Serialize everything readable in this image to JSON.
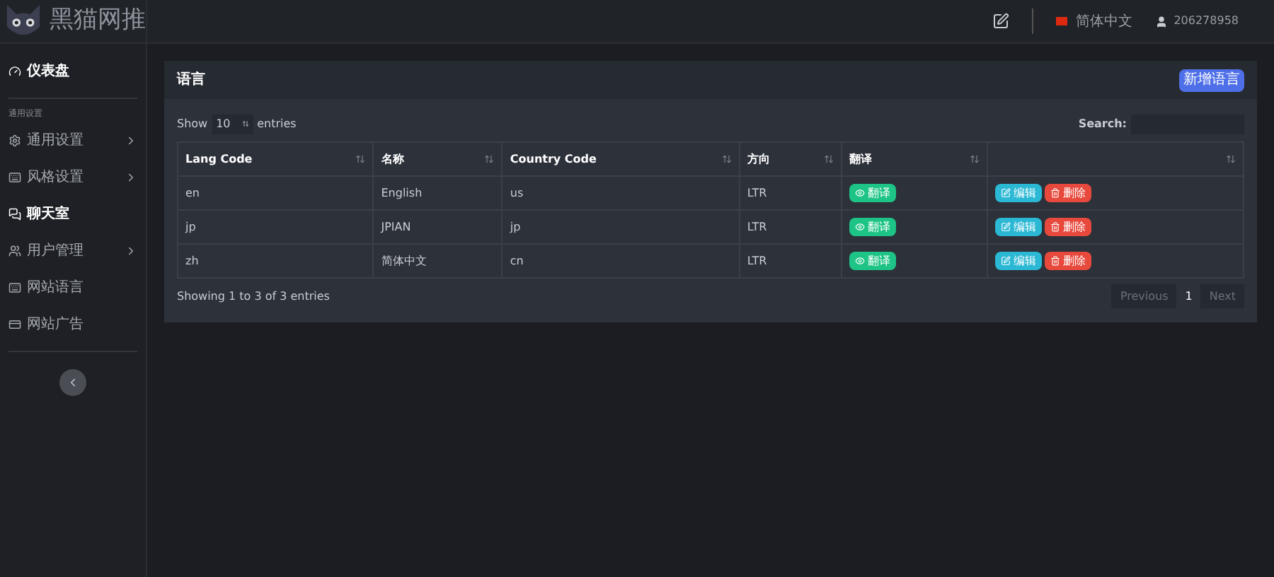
{
  "header": {
    "logo_text": "黑猫网推",
    "language": "简体中文",
    "user": "206278958"
  },
  "sidebar": {
    "items": [
      {
        "kind": "item",
        "label": "仪表盘",
        "active": true,
        "expandable": false
      },
      {
        "kind": "divider"
      },
      {
        "kind": "section",
        "label": "通用设置"
      },
      {
        "kind": "item",
        "label": "通用设置",
        "active": false,
        "expandable": true
      },
      {
        "kind": "item",
        "label": "风格设置",
        "active": false,
        "expandable": true
      },
      {
        "kind": "item",
        "label": "聊天室",
        "active": true,
        "expandable": false
      },
      {
        "kind": "item",
        "label": "用户管理",
        "active": false,
        "expandable": true
      },
      {
        "kind": "item",
        "label": "网站语言",
        "active": false,
        "expandable": false
      },
      {
        "kind": "item",
        "label": "网站广告",
        "active": false,
        "expandable": false
      },
      {
        "kind": "divider"
      }
    ]
  },
  "panel": {
    "title": "语言",
    "add_button": "新增语言",
    "show_label": "Show",
    "page_size": "10",
    "entries_label": "entries",
    "search_label": "Search:",
    "table": {
      "columns": [
        "Lang Code",
        "名称",
        "Country Code",
        "方向",
        "翻译"
      ],
      "rows": [
        {
          "code": "en",
          "name": "English",
          "country": "us",
          "direction": "LTR",
          "translate": "翻译",
          "edit": "编辑",
          "delete": "删除"
        },
        {
          "code": "jp",
          "name": "JPIAN",
          "country": "jp",
          "direction": "LTR",
          "translate": "翻译",
          "edit": "编辑",
          "delete": "删除"
        },
        {
          "code": "zh",
          "name": "简体中文",
          "country": "cn",
          "direction": "LTR",
          "translate": "翻译",
          "edit": "编辑",
          "delete": "删除"
        }
      ]
    },
    "info": "Showing 1 to 3 of 3 entries",
    "pagination": {
      "previous": {
        "label": "Previous",
        "disabled": true
      },
      "pages": [
        {
          "label": "1",
          "selected": true
        }
      ],
      "next": {
        "label": "Next",
        "disabled": true
      }
    }
  }
}
